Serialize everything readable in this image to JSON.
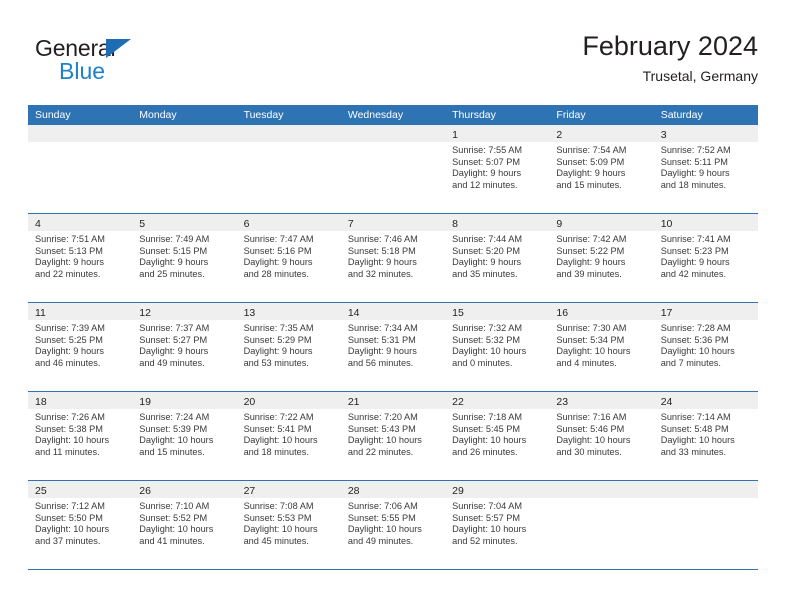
{
  "brand": {
    "name_part1": "General",
    "name_part2": "Blue",
    "accent_color": "#2081c9",
    "triangle_color": "#1d6cb4"
  },
  "header": {
    "title": "February 2024",
    "subtitle": "Trusetal, Germany"
  },
  "calendar": {
    "header_bg": "#2e74b5",
    "day_band_bg": "#efeff0",
    "weekdays": [
      "Sunday",
      "Monday",
      "Tuesday",
      "Wednesday",
      "Thursday",
      "Friday",
      "Saturday"
    ],
    "weeks": [
      [
        {
          "day": "",
          "sunrise": "",
          "sunset": "",
          "daylight_line1": "",
          "daylight_line2": ""
        },
        {
          "day": "",
          "sunrise": "",
          "sunset": "",
          "daylight_line1": "",
          "daylight_line2": ""
        },
        {
          "day": "",
          "sunrise": "",
          "sunset": "",
          "daylight_line1": "",
          "daylight_line2": ""
        },
        {
          "day": "",
          "sunrise": "",
          "sunset": "",
          "daylight_line1": "",
          "daylight_line2": ""
        },
        {
          "day": "1",
          "sunrise": "Sunrise: 7:55 AM",
          "sunset": "Sunset: 5:07 PM",
          "daylight_line1": "Daylight: 9 hours",
          "daylight_line2": "and 12 minutes."
        },
        {
          "day": "2",
          "sunrise": "Sunrise: 7:54 AM",
          "sunset": "Sunset: 5:09 PM",
          "daylight_line1": "Daylight: 9 hours",
          "daylight_line2": "and 15 minutes."
        },
        {
          "day": "3",
          "sunrise": "Sunrise: 7:52 AM",
          "sunset": "Sunset: 5:11 PM",
          "daylight_line1": "Daylight: 9 hours",
          "daylight_line2": "and 18 minutes."
        }
      ],
      [
        {
          "day": "4",
          "sunrise": "Sunrise: 7:51 AM",
          "sunset": "Sunset: 5:13 PM",
          "daylight_line1": "Daylight: 9 hours",
          "daylight_line2": "and 22 minutes."
        },
        {
          "day": "5",
          "sunrise": "Sunrise: 7:49 AM",
          "sunset": "Sunset: 5:15 PM",
          "daylight_line1": "Daylight: 9 hours",
          "daylight_line2": "and 25 minutes."
        },
        {
          "day": "6",
          "sunrise": "Sunrise: 7:47 AM",
          "sunset": "Sunset: 5:16 PM",
          "daylight_line1": "Daylight: 9 hours",
          "daylight_line2": "and 28 minutes."
        },
        {
          "day": "7",
          "sunrise": "Sunrise: 7:46 AM",
          "sunset": "Sunset: 5:18 PM",
          "daylight_line1": "Daylight: 9 hours",
          "daylight_line2": "and 32 minutes."
        },
        {
          "day": "8",
          "sunrise": "Sunrise: 7:44 AM",
          "sunset": "Sunset: 5:20 PM",
          "daylight_line1": "Daylight: 9 hours",
          "daylight_line2": "and 35 minutes."
        },
        {
          "day": "9",
          "sunrise": "Sunrise: 7:42 AM",
          "sunset": "Sunset: 5:22 PM",
          "daylight_line1": "Daylight: 9 hours",
          "daylight_line2": "and 39 minutes."
        },
        {
          "day": "10",
          "sunrise": "Sunrise: 7:41 AM",
          "sunset": "Sunset: 5:23 PM",
          "daylight_line1": "Daylight: 9 hours",
          "daylight_line2": "and 42 minutes."
        }
      ],
      [
        {
          "day": "11",
          "sunrise": "Sunrise: 7:39 AM",
          "sunset": "Sunset: 5:25 PM",
          "daylight_line1": "Daylight: 9 hours",
          "daylight_line2": "and 46 minutes."
        },
        {
          "day": "12",
          "sunrise": "Sunrise: 7:37 AM",
          "sunset": "Sunset: 5:27 PM",
          "daylight_line1": "Daylight: 9 hours",
          "daylight_line2": "and 49 minutes."
        },
        {
          "day": "13",
          "sunrise": "Sunrise: 7:35 AM",
          "sunset": "Sunset: 5:29 PM",
          "daylight_line1": "Daylight: 9 hours",
          "daylight_line2": "and 53 minutes."
        },
        {
          "day": "14",
          "sunrise": "Sunrise: 7:34 AM",
          "sunset": "Sunset: 5:31 PM",
          "daylight_line1": "Daylight: 9 hours",
          "daylight_line2": "and 56 minutes."
        },
        {
          "day": "15",
          "sunrise": "Sunrise: 7:32 AM",
          "sunset": "Sunset: 5:32 PM",
          "daylight_line1": "Daylight: 10 hours",
          "daylight_line2": "and 0 minutes."
        },
        {
          "day": "16",
          "sunrise": "Sunrise: 7:30 AM",
          "sunset": "Sunset: 5:34 PM",
          "daylight_line1": "Daylight: 10 hours",
          "daylight_line2": "and 4 minutes."
        },
        {
          "day": "17",
          "sunrise": "Sunrise: 7:28 AM",
          "sunset": "Sunset: 5:36 PM",
          "daylight_line1": "Daylight: 10 hours",
          "daylight_line2": "and 7 minutes."
        }
      ],
      [
        {
          "day": "18",
          "sunrise": "Sunrise: 7:26 AM",
          "sunset": "Sunset: 5:38 PM",
          "daylight_line1": "Daylight: 10 hours",
          "daylight_line2": "and 11 minutes."
        },
        {
          "day": "19",
          "sunrise": "Sunrise: 7:24 AM",
          "sunset": "Sunset: 5:39 PM",
          "daylight_line1": "Daylight: 10 hours",
          "daylight_line2": "and 15 minutes."
        },
        {
          "day": "20",
          "sunrise": "Sunrise: 7:22 AM",
          "sunset": "Sunset: 5:41 PM",
          "daylight_line1": "Daylight: 10 hours",
          "daylight_line2": "and 18 minutes."
        },
        {
          "day": "21",
          "sunrise": "Sunrise: 7:20 AM",
          "sunset": "Sunset: 5:43 PM",
          "daylight_line1": "Daylight: 10 hours",
          "daylight_line2": "and 22 minutes."
        },
        {
          "day": "22",
          "sunrise": "Sunrise: 7:18 AM",
          "sunset": "Sunset: 5:45 PM",
          "daylight_line1": "Daylight: 10 hours",
          "daylight_line2": "and 26 minutes."
        },
        {
          "day": "23",
          "sunrise": "Sunrise: 7:16 AM",
          "sunset": "Sunset: 5:46 PM",
          "daylight_line1": "Daylight: 10 hours",
          "daylight_line2": "and 30 minutes."
        },
        {
          "day": "24",
          "sunrise": "Sunrise: 7:14 AM",
          "sunset": "Sunset: 5:48 PM",
          "daylight_line1": "Daylight: 10 hours",
          "daylight_line2": "and 33 minutes."
        }
      ],
      [
        {
          "day": "25",
          "sunrise": "Sunrise: 7:12 AM",
          "sunset": "Sunset: 5:50 PM",
          "daylight_line1": "Daylight: 10 hours",
          "daylight_line2": "and 37 minutes."
        },
        {
          "day": "26",
          "sunrise": "Sunrise: 7:10 AM",
          "sunset": "Sunset: 5:52 PM",
          "daylight_line1": "Daylight: 10 hours",
          "daylight_line2": "and 41 minutes."
        },
        {
          "day": "27",
          "sunrise": "Sunrise: 7:08 AM",
          "sunset": "Sunset: 5:53 PM",
          "daylight_line1": "Daylight: 10 hours",
          "daylight_line2": "and 45 minutes."
        },
        {
          "day": "28",
          "sunrise": "Sunrise: 7:06 AM",
          "sunset": "Sunset: 5:55 PM",
          "daylight_line1": "Daylight: 10 hours",
          "daylight_line2": "and 49 minutes."
        },
        {
          "day": "29",
          "sunrise": "Sunrise: 7:04 AM",
          "sunset": "Sunset: 5:57 PM",
          "daylight_line1": "Daylight: 10 hours",
          "daylight_line2": "and 52 minutes."
        },
        {
          "day": "",
          "sunrise": "",
          "sunset": "",
          "daylight_line1": "",
          "daylight_line2": ""
        },
        {
          "day": "",
          "sunrise": "",
          "sunset": "",
          "daylight_line1": "",
          "daylight_line2": ""
        }
      ]
    ]
  }
}
